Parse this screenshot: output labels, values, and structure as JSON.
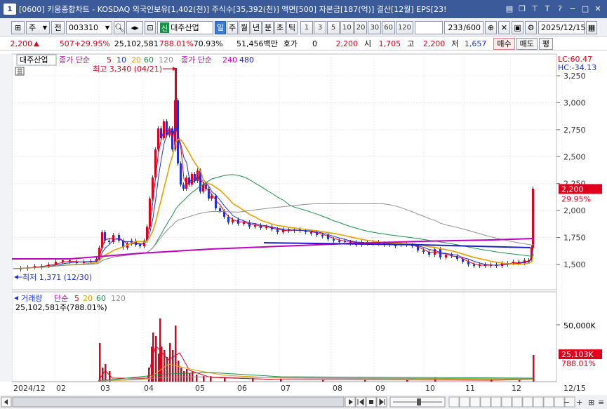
{
  "titlebar": {
    "num": "1",
    "text": "[0600] 키움종합차트 - KOSDAQ 외국인보유[1,402(천)] 주식수[35,392(천)] 액면[500] 자본금[187(억)] 결산[12월] EPS[23!"
  },
  "toolbar": {
    "type_select": "주",
    "prev_label": "전",
    "code": "003310",
    "stock_name": "대주산업",
    "sin_badge": "신",
    "periods": [
      "일",
      "주",
      "월",
      "년",
      "분",
      "초",
      "틱"
    ],
    "selected_period": "일",
    "minute_options": [
      "1",
      "3",
      "5",
      "10",
      "20",
      "30",
      "60",
      "120"
    ],
    "count": "233",
    "count_total": "/600",
    "date": "2025/12/15"
  },
  "price_bar": {
    "price": "2,200",
    "change": "507",
    "change_pct": "+29.95%",
    "volume": "25,102,581",
    "vol_ratio": "788.01%",
    "turnover": "70.93%",
    "amount": "51,456백만",
    "hoga_label": "호가",
    "hoga_value": "0",
    "hoga_price": "2,200",
    "open_label": "시",
    "open_value": "1,705",
    "high_label": "고",
    "high_value": "2,200",
    "low_label": "저",
    "low_value": "1,657",
    "buy_label": "매수",
    "sell_label": "매도",
    "eval_label": "평"
  },
  "chart": {
    "stock_tag": "대주산업",
    "ma_label_1": "종가 단순",
    "ma_periods_1": [
      "5",
      "10",
      "20",
      "60",
      "120"
    ],
    "ma_label_2": "종가 단순",
    "ma_periods_2": [
      "240",
      "480"
    ],
    "high_annotation": "최고 3,340 (04/21)",
    "low_annotation": "최저 1,371 (12/30)",
    "lc": "LC:60.47",
    "hc": "HC:-34.13",
    "price_ticks": [
      "3,250",
      "3,000",
      "2,750",
      "2,500",
      "2,250",
      "2,000",
      "1,750",
      "1,500"
    ],
    "last_price_tag": "2,200",
    "last_pct_tag": "29.95%",
    "volume_label": "거래량",
    "volume_ma_label": "단순",
    "volume_ma_periods": [
      "5",
      "20",
      "60",
      "120"
    ],
    "volume_info": "25,102,581주(788.01%)",
    "vol_tick": "50,000K",
    "vol_tag": "25,103K",
    "vol_pct_tag": "788.01%",
    "x_labels": [
      "2024/12",
      "02",
      "03",
      "04",
      "05",
      "06",
      "07",
      "08",
      "09",
      "10",
      "11",
      "12",
      "12/15"
    ]
  },
  "colors": {
    "ma5": "#e0001b",
    "ma10": "#1a34d6",
    "ma20": "#e8a000",
    "ma60": "#1a8f4a",
    "ma120": "#909090",
    "ma240": "#c000c0",
    "ma480": "#2020c0",
    "up": "#e0001b",
    "down": "#1a34d6"
  }
}
